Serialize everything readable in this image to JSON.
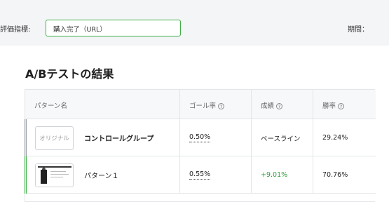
{
  "filter": {
    "label": "評価指標:",
    "selected": "購入完了（URL）",
    "period_label": "期間："
  },
  "results": {
    "title": "A/Bテストの結果",
    "columns": [
      {
        "label": "パターン名"
      },
      {
        "label": "ゴール率",
        "help_icon": "question-circle-icon"
      },
      {
        "label": "成績",
        "help_icon": "question-circle-icon"
      },
      {
        "label": "勝率",
        "help_icon": "question-circle-icon"
      }
    ],
    "rows": [
      {
        "thumbnail_text": "オリジナル",
        "name": "コントロールグループ",
        "goal_rate": "0.50%",
        "performance": "ベースライン",
        "win_rate": "29.24%",
        "accent_color": "#9aa0a6"
      },
      {
        "name": "パターン１",
        "goal_rate": "0.55%",
        "performance": "+9.01%",
        "win_rate": "70.76%",
        "accent_color": "#3fae49"
      }
    ]
  },
  "colors": {
    "accent_green": "#3fae49",
    "positive_text": "#2e9e3a"
  }
}
